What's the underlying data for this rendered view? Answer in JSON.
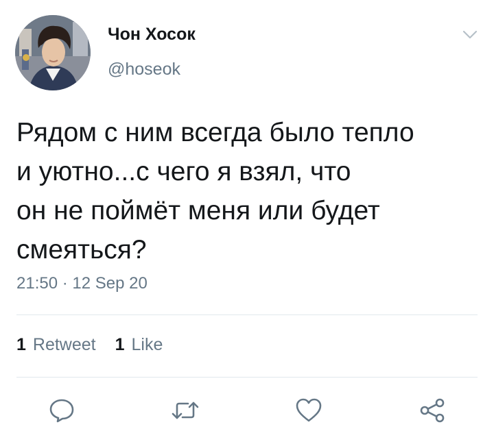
{
  "tweet": {
    "display_name": "Чон Хосок",
    "handle": "@hoseok",
    "text_lines": [
      "Рядом с ним всегда было тепло",
      "и уютно...с чего я взял, что",
      "он не поймёт меня или будет",
      "смеяться?"
    ],
    "timestamp": "21:50 · 12 Sep 20",
    "retweet_count": "1",
    "retweet_label": "Retweet",
    "like_count": "1",
    "like_label": "Like"
  },
  "icons": {
    "caret": "chevron-down-icon",
    "reply": "reply-icon",
    "retweet": "retweet-icon",
    "like": "heart-icon",
    "share": "share-icon"
  },
  "colors": {
    "text_primary": "#14171a",
    "text_secondary": "#657786",
    "divider": "#e1e8ed",
    "icon": "#657786"
  }
}
